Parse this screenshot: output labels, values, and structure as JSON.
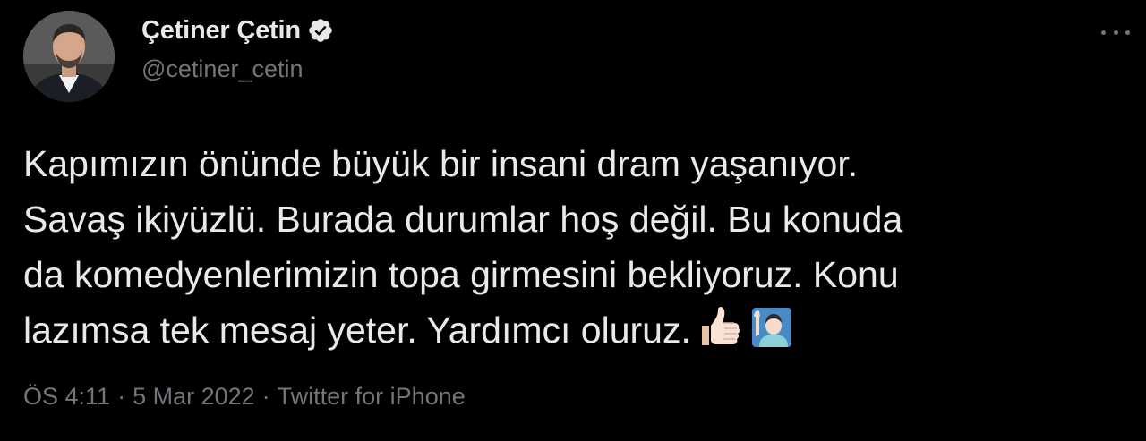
{
  "author": {
    "display_name": "Çetiner Çetin",
    "handle": "@cetiner_cetin",
    "verified": true
  },
  "tweet": {
    "lines": [
      "Kapımızın önünde büyük bir insani dram yaşanıyor.",
      "Savaş ikiyüzlü. Burada durumlar hoş değil. Bu konuda",
      "da komedyenlerimizin topa girmesini bekliyoruz. Konu",
      "lazımsa tek mesaj yeter. Yardımcı oluruz."
    ],
    "emojis": [
      "thumbs-up-icon",
      "raising-hand-man-icon"
    ]
  },
  "meta": {
    "time": "ÖS 4:11",
    "separator": "·",
    "date": "5 Mar 2022",
    "source": "Twitter for iPhone"
  },
  "colors": {
    "background": "#000000",
    "text": "#e7e9ea",
    "secondary": "#71767b"
  }
}
